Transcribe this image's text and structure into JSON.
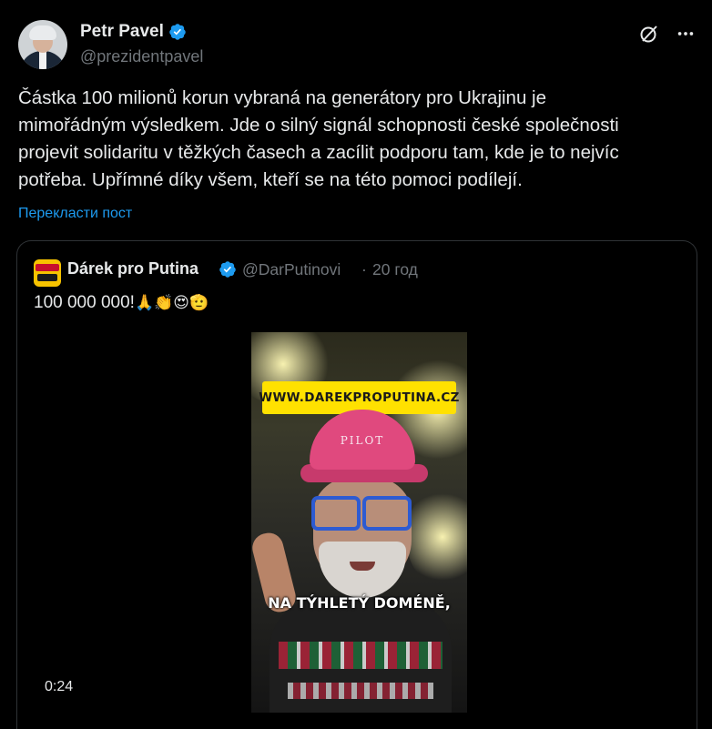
{
  "author": {
    "name": "Petr Pavel",
    "handle": "@prezidentpavel"
  },
  "icons": {
    "grok": "grok-slash-circle-icon",
    "more": "more-horizontal-icon",
    "verified": "verified-badge-icon"
  },
  "tweet": {
    "text": "Částka 100 milionů korun vybraná na generátory pro Ukrajinu je\nmimořádným výsledkem. Jde o silný signál schopnosti české společnosti\nprojevit solidaritu v těžkých časech a zacílit podporu tam, kde je to nejvíc\npotřeba. Upřímné díky všem, kteří se na této pomoci podílejí.",
    "translate_label": "Перекласти пост"
  },
  "quoted": {
    "name": "Dárek pro Putina",
    "handle": "@DarPutinovi",
    "separator": "·",
    "time": "20 год",
    "text": "100 000 000!",
    "emojis": "🙏👏😍🫡",
    "video": {
      "banner_text": "WWW.DAREKPROPUTINA.CZ",
      "cap_text": "PILOT",
      "caption": "NA TÝHLETÝ DOMÉNĚ,",
      "duration": "0:24"
    }
  },
  "colors": {
    "background": "#000000",
    "text": "#e7e9ea",
    "muted": "#71767b",
    "link": "#1d9bf0",
    "border": "#2f3336",
    "verified": "#1d9bf0"
  }
}
